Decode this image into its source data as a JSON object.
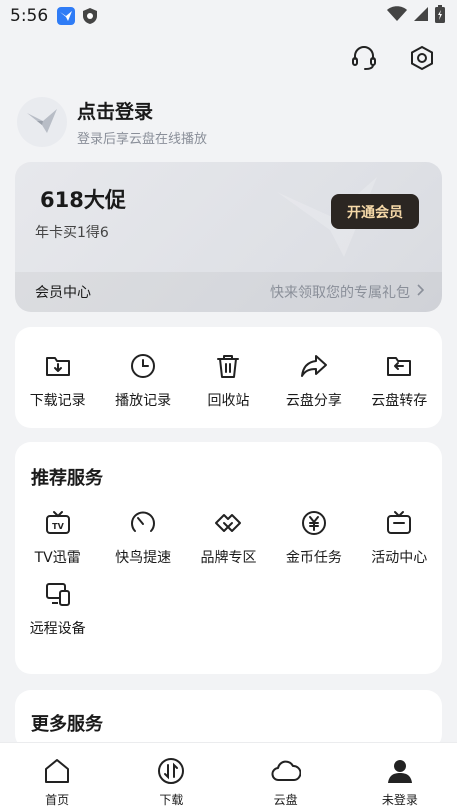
{
  "status_bar": {
    "time": "5:56"
  },
  "header": {
    "support_icon": "headset-icon",
    "settings_icon": "hexagon-settings-icon"
  },
  "profile": {
    "title": "点击登录",
    "subtitle": "登录后享云盘在线播放"
  },
  "vip_card": {
    "title": "618大促",
    "subtitle": "年卡买1得6",
    "button": "开通会员",
    "center_label": "会员中心",
    "center_hint": "快来领取您的专属礼包"
  },
  "quick_actions": [
    {
      "label": "下载记录",
      "icon": "download-folder-icon"
    },
    {
      "label": "播放记录",
      "icon": "clock-icon"
    },
    {
      "label": "回收站",
      "icon": "trash-icon"
    },
    {
      "label": "云盘分享",
      "icon": "share-icon"
    },
    {
      "label": "云盘转存",
      "icon": "transfer-folder-icon"
    }
  ],
  "recommended": {
    "title": "推荐服务",
    "items": [
      {
        "label": "TV迅雷",
        "icon": "tv-icon"
      },
      {
        "label": "快鸟提速",
        "icon": "speedometer-icon"
      },
      {
        "label": "品牌专区",
        "icon": "handshake-icon"
      },
      {
        "label": "金币任务",
        "icon": "coin-icon"
      },
      {
        "label": "活动中心",
        "icon": "event-icon"
      },
      {
        "label": "远程设备",
        "icon": "devices-icon"
      }
    ]
  },
  "more_services": {
    "title": "更多服务"
  },
  "tabbar": [
    {
      "label": "首页",
      "icon": "home-icon"
    },
    {
      "label": "下载",
      "icon": "download-icon"
    },
    {
      "label": "云盘",
      "icon": "cloud-icon"
    },
    {
      "label": "未登录",
      "icon": "user-icon"
    }
  ]
}
